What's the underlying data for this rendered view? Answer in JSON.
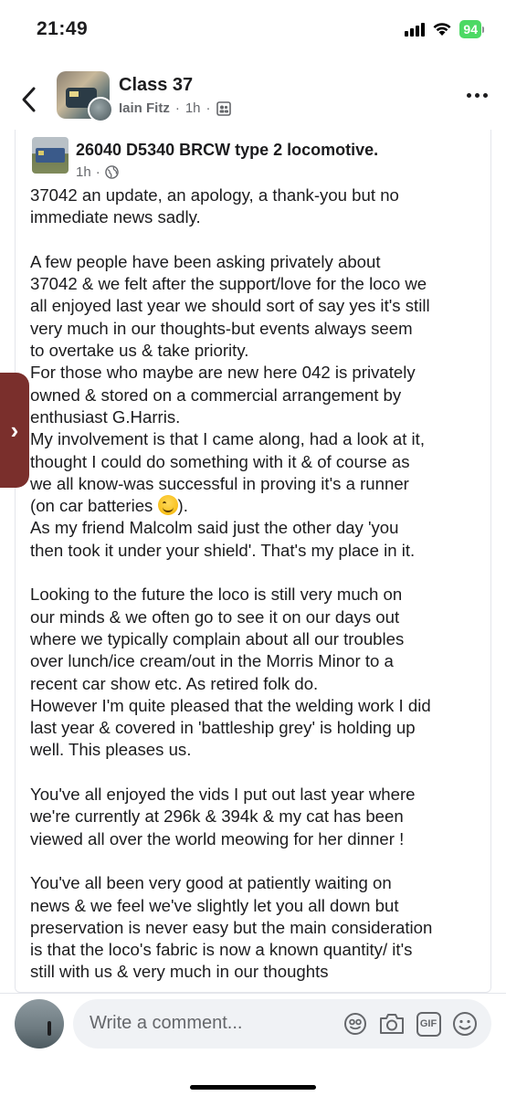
{
  "status_bar": {
    "time": "21:49",
    "battery": "94"
  },
  "header": {
    "group_name": "Class 37",
    "author": "Iain Fitz",
    "time": "1h",
    "separator": "·"
  },
  "shared_post": {
    "title": "26040 D5340 BRCW type 2 locomotive.",
    "time": "1h",
    "separator": "·",
    "paragraphs": [
      [
        "37042 an update, an apology, a thank-you but no",
        "immediate news sadly."
      ],
      [
        "A few people have been asking privately about",
        "37042 & we felt after the support/love for the loco we",
        "all enjoyed last year we should sort of say yes it's still",
        "very much in our thoughts-but events always seem",
        "to overtake us & take priority.",
        "For those who maybe are new here 042 is privately",
        "owned & stored on a commercial arrangement by",
        "enthusiast G.Harris.",
        "My involvement is that I came along, had a look at it,",
        "thought I could do something with it & of course as",
        "we all know-was successful in proving it's a runner",
        "(on car batteries",
        "As my friend Malcolm said just the other day 'you",
        "then took it under your shield'. That's my place in it."
      ],
      [
        "Looking to the future the loco is still very much on",
        "our minds & we often go to see it on our days out",
        "where we typically complain about all our troubles",
        "over lunch/ice cream/out in the Morris Minor to a",
        "recent car show etc. As retired folk do.",
        "However I'm quite pleased that the welding work I did",
        "last year & covered in 'battleship grey' is holding up",
        "well. This pleases us."
      ],
      [
        "You've all enjoyed the vids I put out last year where",
        "we're currently at 296k & 394k & my cat has been",
        "viewed all over the world meowing for her dinner !"
      ],
      [
        "You've all been very good at patiently waiting on",
        "news & we feel we've slightly let you all down but",
        "preservation is never easy but the main consideration",
        "is that the loco's fabric is now a known quantity/ it's",
        "still with us & very much in our thoughts"
      ]
    ],
    "emoji_line_suffix": ")."
  },
  "side_tab": {
    "label": "›"
  },
  "comment_bar": {
    "placeholder": "Write a comment...",
    "gif_label": "GIF"
  },
  "icons": {
    "back": "chevron-left-icon",
    "more": "more-horizontal-icon",
    "globe": "globe-icon",
    "group": "group-icon",
    "avatar_frame": "avatar-frame-icon",
    "camera": "camera-icon",
    "gif": "gif-icon",
    "emoji": "emoji-icon"
  },
  "colors": {
    "text": "#1c1c1e",
    "muted": "#65676b",
    "battery": "#4cd964",
    "side_tab": "#7a2f2c",
    "input_bg": "#f0f2f5"
  }
}
